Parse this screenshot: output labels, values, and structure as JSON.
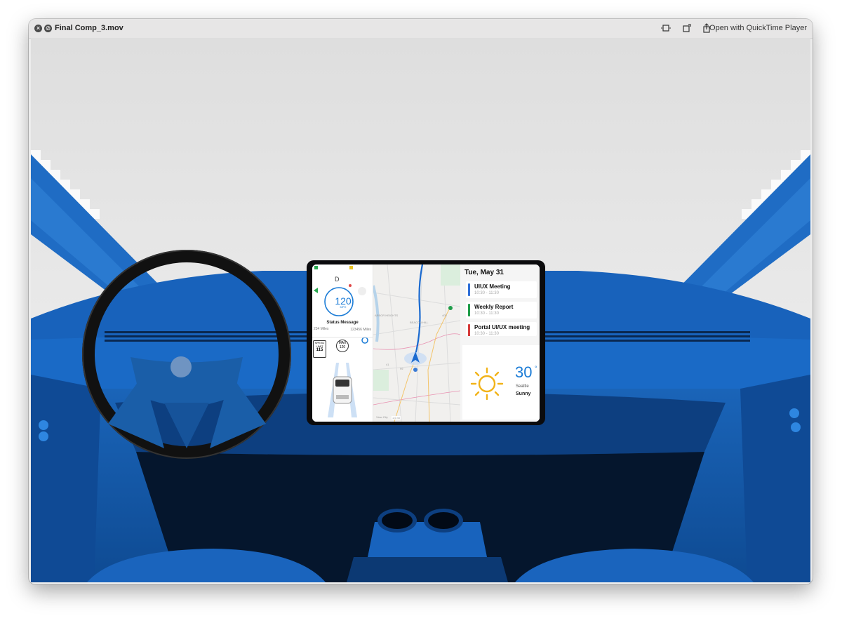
{
  "window": {
    "title": "Final Comp_3.mov",
    "open_with_label": "Open with QuickTime Player",
    "icons": [
      "close-icon",
      "stop-icon",
      "trim-icon",
      "rotate-icon",
      "share-icon"
    ]
  },
  "dashboard": {
    "cluster": {
      "gear": "D",
      "speed": "120",
      "speed_unit": "MPH",
      "status_message": "Status Message",
      "trip_miles": "234 Miles",
      "odometer": "123456 Miles",
      "speed_limit_label": "SPEED LIMIT",
      "speed_limit_value": "115",
      "max_label": "MAX",
      "max_value": "120"
    },
    "map": {
      "labels": [
        "ARBOR HEIGHTS",
        "BEACON HILL",
        "41",
        "99",
        "405",
        "View City",
        "1.6 mi"
      ]
    },
    "calendar": {
      "date": "Tue, May 31",
      "events": [
        {
          "name": "UIUX Meeting",
          "time": "10:30 - 11:30",
          "color": "#2f6fd8"
        },
        {
          "name": "Weekly Report",
          "time": "10:30 - 11:30",
          "color": "#1e9c49"
        },
        {
          "name": "Portal UI/UX meeting",
          "time": "10:30 - 11:30",
          "color": "#d63b3b"
        }
      ]
    },
    "weather": {
      "temperature": "30",
      "degree": "°",
      "city": "Seattle",
      "condition": "Sunny",
      "icon": "sun-icon"
    }
  },
  "colors": {
    "accent_blue": "#1a7bd6",
    "dash_blue": "#1560b8",
    "sky_gray": "#e4e4e4"
  }
}
